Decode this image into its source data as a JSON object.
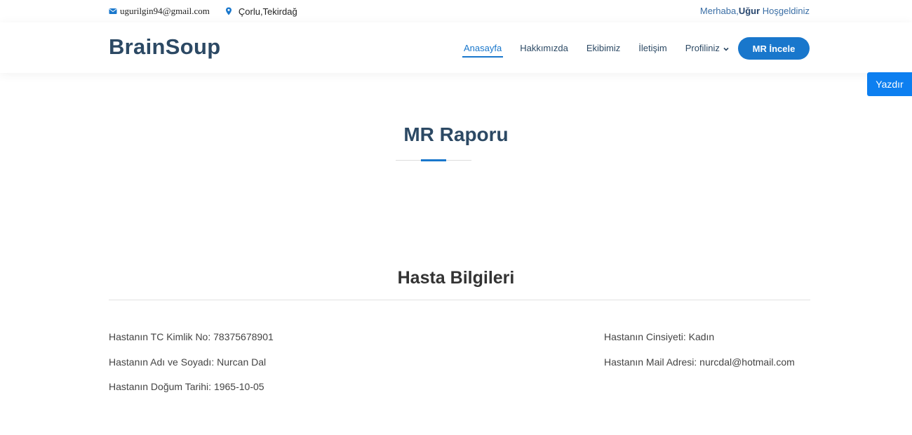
{
  "topbar": {
    "email": "ugurilgin94@gmail.com",
    "location": "Çorlu,Tekirdağ",
    "greeting_prefix": "Merhaba,",
    "greeting_name": "Uğur",
    "greeting_suffix": " Hoşgeldiniz"
  },
  "header": {
    "logo": "BrainSoup",
    "nav": {
      "home": "Anasayfa",
      "about": "Hakkımızda",
      "team": "Ekibimiz",
      "contact": "İletişim",
      "profile": "Profiliniz"
    },
    "mr_button": "MR İncele"
  },
  "print_button": "Yazdır",
  "main": {
    "title": "MR Raporu",
    "patient_section_title": "Hasta Bilgileri",
    "patient": {
      "tc_label": "Hastanın TC Kimlik No: ",
      "tc_value": "78375678901",
      "name_label": "Hastanın Adı ve Soyadı: ",
      "name_value": "Nurcan Dal",
      "birth_label": "Hastanın Doğum Tarihi: ",
      "birth_value": "1965-10-05",
      "gender_label": "Hastanın Cinsiyeti: ",
      "gender_value": "Kadın",
      "mail_label": "Hastanın Mail Adresi: ",
      "mail_value": "nurcdal@hotmail.com"
    }
  },
  "colors": {
    "accent": "#1977cc",
    "heading": "#2c4964",
    "print_button": "#0d7ff0"
  }
}
